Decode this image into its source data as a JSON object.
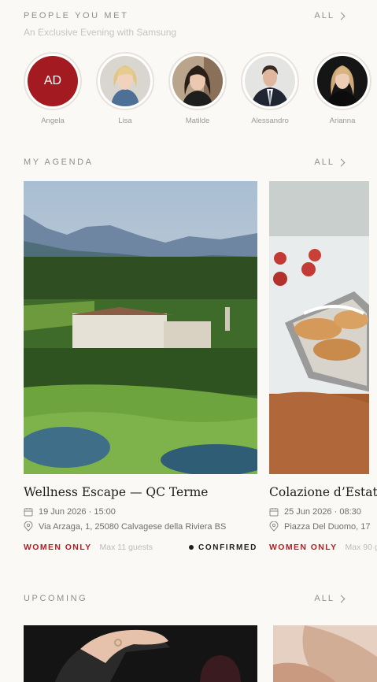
{
  "people": {
    "title": "PEOPLE YOU MET",
    "subtitle": "An Exclusive Evening with Samsung",
    "all_label": "ALL",
    "items": [
      {
        "name": "Angela",
        "initials": "AD"
      },
      {
        "name": "Lisa"
      },
      {
        "name": "Matilde"
      },
      {
        "name": "Alessandro"
      },
      {
        "name": "Arianna"
      }
    ]
  },
  "agenda": {
    "title": "MY AGENDA",
    "all_label": "ALL",
    "cards": [
      {
        "title": "Wellness Escape — QC Terme",
        "datetime": "19 Jun 2026 · 15:00",
        "address": "Via Arzaga, 1, 25080 Calvagese della Riviera BS",
        "tag": "WOMEN ONLY",
        "guests": "Max 11 guests",
        "status": "CONFIRMED"
      },
      {
        "title": "Colazione d’Estate",
        "datetime": "25 Jun 2026 · 08:30",
        "address": "Piazza Del Duomo, 17",
        "tag": "WOMEN ONLY",
        "guests": "Max 90 g"
      }
    ]
  },
  "upcoming": {
    "title": "UPCOMING",
    "all_label": "ALL"
  },
  "colors": {
    "accent_red": "#b01e24",
    "avatar_red": "#a31b21",
    "background": "#fbf9f6"
  }
}
